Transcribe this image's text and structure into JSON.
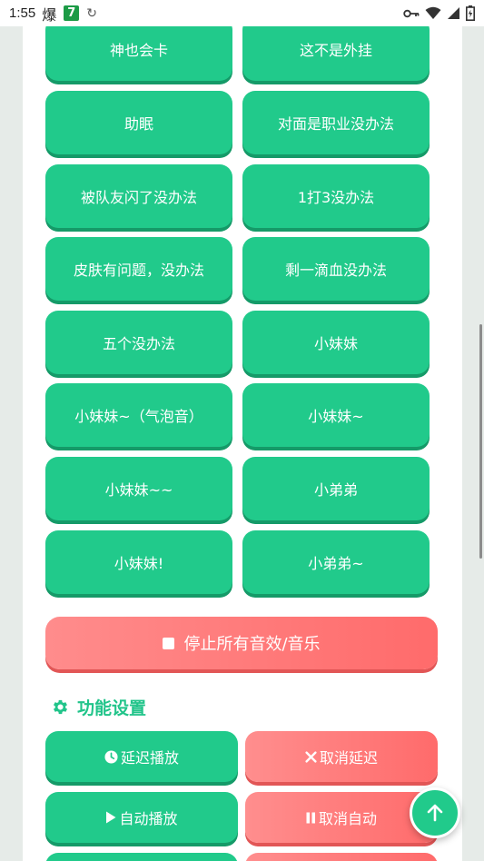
{
  "status_bar": {
    "time": "1:55",
    "badge_char": "爆",
    "seven": "7",
    "sync_glyph": "↻"
  },
  "sound_buttons": [
    "神也会卡",
    "这不是外挂",
    "助眠",
    "对面是职业没办法",
    "被队友闪了没办法",
    "1打3没办法",
    "皮肤有问题，没办法",
    "剩一滴血没办法",
    "五个没办法",
    "小妹妹",
    "小妹妹~（气泡音）",
    "小妹妹~",
    "小妹妹~~",
    "小弟弟",
    "小妹妹!",
    "小弟弟~"
  ],
  "stop_all": {
    "label": "停止所有音效/音乐",
    "icon": "stop-icon"
  },
  "section": {
    "title": "功能设置",
    "icon": "gear-icon"
  },
  "function_buttons": {
    "delay_play": "延迟播放",
    "cancel_delay": "取消延迟",
    "auto_play": "自动播放",
    "cancel_auto": "取消自动"
  },
  "colors": {
    "accent_green": "#21ca8b",
    "accent_red": "#ff6b6b"
  }
}
